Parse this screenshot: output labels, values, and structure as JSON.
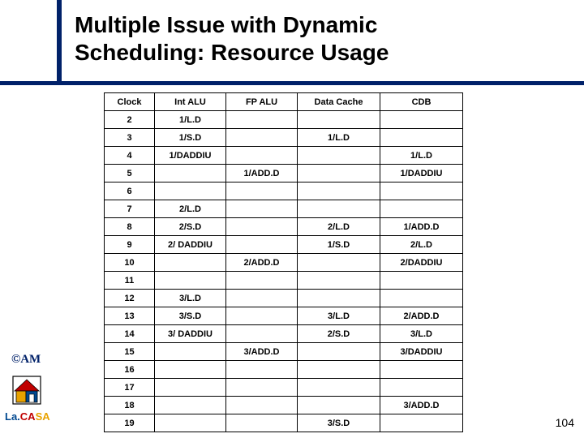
{
  "title_line1": "Multiple Issue with Dynamic",
  "title_line2": "Scheduling: Resource Usage",
  "headers": [
    "Clock",
    "Int ALU",
    "FP ALU",
    "Data Cache",
    "CDB"
  ],
  "rows": [
    {
      "clock": "2",
      "int": "1/L.D",
      "fp": "",
      "dc": "",
      "cdb": ""
    },
    {
      "clock": "3",
      "int": "1/S.D",
      "fp": "",
      "dc": "1/L.D",
      "cdb": ""
    },
    {
      "clock": "4",
      "int": "1/DADDIU",
      "fp": "",
      "dc": "",
      "cdb": "1/L.D"
    },
    {
      "clock": "5",
      "int": "",
      "fp": "1/ADD.D",
      "dc": "",
      "cdb": "1/DADDIU"
    },
    {
      "clock": "6",
      "int": "",
      "fp": "",
      "dc": "",
      "cdb": ""
    },
    {
      "clock": "7",
      "int": "2/L.D",
      "fp": "",
      "dc": "",
      "cdb": ""
    },
    {
      "clock": "8",
      "int": "2/S.D",
      "fp": "",
      "dc": "2/L.D",
      "cdb": "1/ADD.D"
    },
    {
      "clock": "9",
      "int": "2/ DADDIU",
      "fp": "",
      "dc": "1/S.D",
      "cdb": "2/L.D"
    },
    {
      "clock": "10",
      "int": "",
      "fp": "2/ADD.D",
      "dc": "",
      "cdb": "2/DADDIU"
    },
    {
      "clock": "11",
      "int": "",
      "fp": "",
      "dc": "",
      "cdb": ""
    },
    {
      "clock": "12",
      "int": "3/L.D",
      "fp": "",
      "dc": "",
      "cdb": ""
    },
    {
      "clock": "13",
      "int": "3/S.D",
      "fp": "",
      "dc": "3/L.D",
      "cdb": "2/ADD.D"
    },
    {
      "clock": "14",
      "int": "3/ DADDIU",
      "fp": "",
      "dc": "2/S.D",
      "cdb": "3/L.D"
    },
    {
      "clock": "15",
      "int": "",
      "fp": "3/ADD.D",
      "dc": "",
      "cdb": "3/DADDIU"
    },
    {
      "clock": "16",
      "int": "",
      "fp": "",
      "dc": "",
      "cdb": ""
    },
    {
      "clock": "17",
      "int": "",
      "fp": "",
      "dc": "",
      "cdb": ""
    },
    {
      "clock": "18",
      "int": "",
      "fp": "",
      "dc": "",
      "cdb": "3/ADD.D"
    },
    {
      "clock": "19",
      "int": "",
      "fp": "",
      "dc": "3/S.D",
      "cdb": ""
    }
  ],
  "logo1": "©AM",
  "logo3": {
    "la": "La.",
    "ca": "CA",
    "sa": "SA"
  },
  "pagenum": "104"
}
